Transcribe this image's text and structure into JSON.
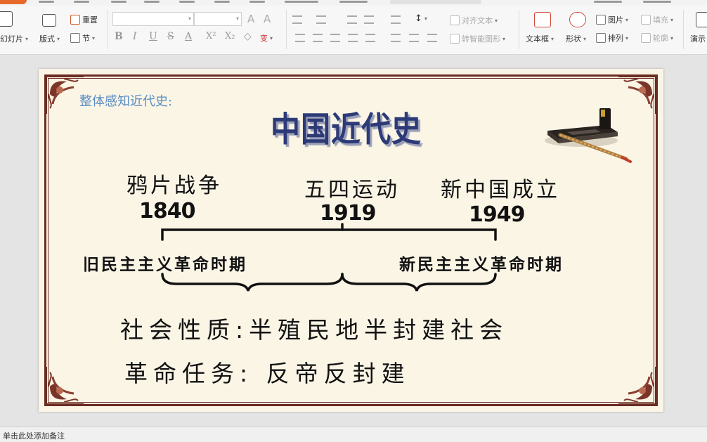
{
  "ribbon": {
    "new_slide_label": "幻灯片",
    "layout_label": "版式",
    "reset_label": "重置",
    "section_label": "节",
    "font_name_value": "",
    "font_size_value": "",
    "grow_font": "A",
    "shrink_font": "A",
    "bold": "B",
    "italic": "I",
    "underline": "U",
    "strike": "S",
    "font_color": "A",
    "superscript": "X²",
    "subscript": "X₂",
    "pinyin_label": "变",
    "align_text_label": "对齐文本",
    "smartart_label": "转智能图形",
    "textbox_label": "文本框",
    "shape_label": "形状",
    "picture_label": "图片",
    "arrange_label": "排列",
    "fill_label": "填充",
    "outline_label": "轮廓",
    "present_label": "演示"
  },
  "slide": {
    "intro_text": "整体感知近代史:",
    "title": "中国近代史",
    "events": [
      {
        "name": "鸦片战争",
        "year": "1840"
      },
      {
        "name": "五四运动",
        "year": "1919"
      },
      {
        "name": "新中国成立",
        "year": "1949"
      }
    ],
    "periods": [
      "旧民主主义革命时期",
      "新民主主义革命时期"
    ],
    "nature": "社会性质:半殖民地半封建社会",
    "task": "革命任务: 反帝反封建"
  },
  "notes": {
    "placeholder": "单击此处添加备注"
  },
  "colors": {
    "accent": "#e86a2a",
    "frame": "#6b2c22",
    "title": "#2d3a78",
    "intro": "#5b8ec4",
    "slide_bg": "#fbf5e6"
  }
}
